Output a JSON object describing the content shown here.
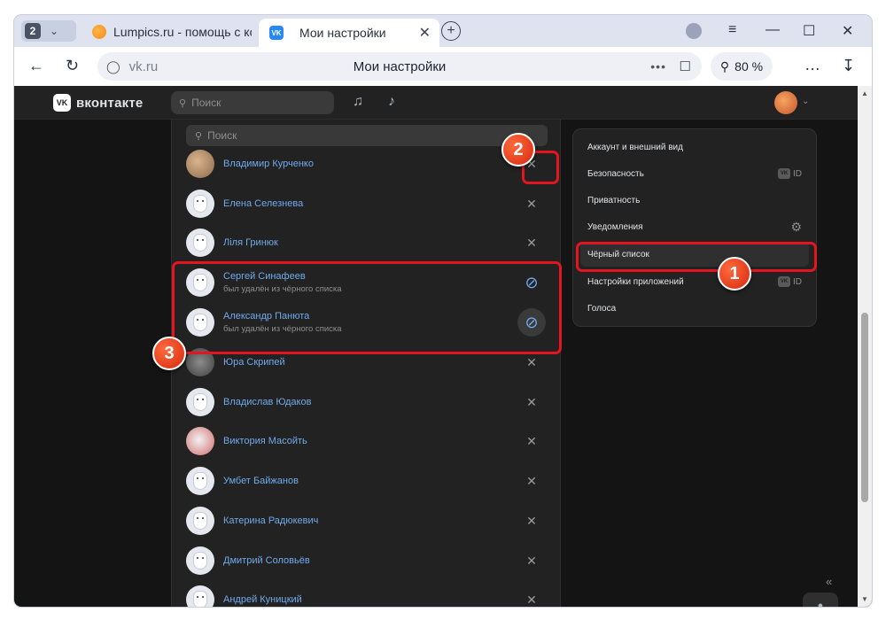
{
  "browser": {
    "tab_count": "2",
    "tabs": [
      {
        "title": "Lumpics.ru - помощь с ком",
        "favicon": "orange-icon"
      },
      {
        "title": "Мои настройки",
        "favicon": "vk-icon"
      }
    ],
    "url_host": "vk.ru",
    "page_title": "Мои настройки",
    "zoom": "80 %",
    "dots": "•••"
  },
  "vk": {
    "logo_text": "вконтакте",
    "logo_mark": "VK",
    "search_placeholder": "Поиск"
  },
  "blacklist": {
    "search_placeholder": "Поиск",
    "users": [
      {
        "name": "Владимир Курченко",
        "status": "",
        "action": "remove",
        "avatar": "photo1"
      },
      {
        "name": "Елена Селезнева",
        "status": "",
        "action": "remove",
        "avatar": "default"
      },
      {
        "name": "Ліля Гринюк",
        "status": "",
        "action": "remove",
        "avatar": "default"
      },
      {
        "name": "Сергей Синафеев",
        "status": "был удалён из чёрного списка",
        "action": "block",
        "avatar": "default"
      },
      {
        "name": "Александр Панюта",
        "status": "был удалён из чёрного списка",
        "action": "block",
        "avatar": "default"
      },
      {
        "name": "Юра Скрипей",
        "status": "",
        "action": "remove",
        "avatar": "photo2"
      },
      {
        "name": "Владислав Юдаков",
        "status": "",
        "action": "remove",
        "avatar": "default"
      },
      {
        "name": "Виктория Масойть",
        "status": "",
        "action": "remove",
        "avatar": "photo3"
      },
      {
        "name": "Умбет Байжанов",
        "status": "",
        "action": "remove",
        "avatar": "default"
      },
      {
        "name": "Катерина Радюкевич",
        "status": "",
        "action": "remove",
        "avatar": "default"
      },
      {
        "name": "Дмитрий Соловьёв",
        "status": "",
        "action": "remove",
        "avatar": "default"
      },
      {
        "name": "Андрей Куницкий",
        "status": "",
        "action": "remove",
        "avatar": "default"
      }
    ]
  },
  "settings_menu": {
    "items": [
      {
        "label": "Аккаунт и внешний вид",
        "right": ""
      },
      {
        "label": "Безопасность",
        "right": "ID"
      },
      {
        "label": "Приватность",
        "right": ""
      },
      {
        "label": "Уведомления",
        "right": "gear"
      },
      {
        "label": "Чёрный список",
        "right": ""
      },
      {
        "label": "Настройки приложений",
        "right": "ID"
      },
      {
        "label": "Голоса",
        "right": ""
      }
    ],
    "active_index": 4
  },
  "annotations": {
    "step1": "1",
    "step2": "2",
    "step3": "3"
  },
  "colors": {
    "vk_bg": "#141414",
    "panel_bg": "#222222",
    "link_blue": "#71aaeb",
    "highlight_red": "#e4151f"
  }
}
